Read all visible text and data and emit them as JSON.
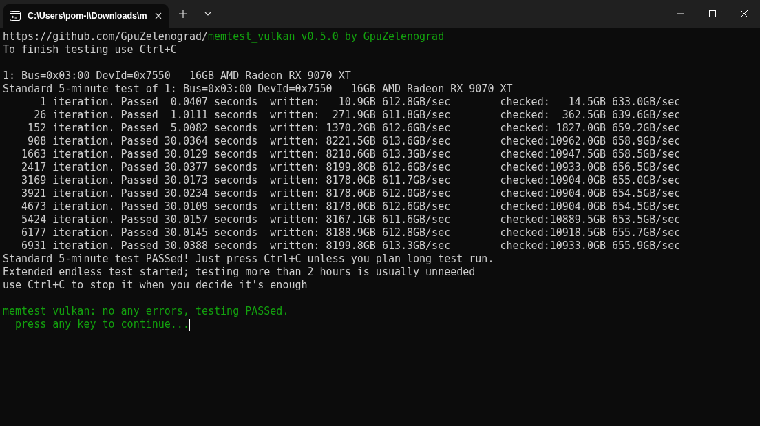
{
  "tab": {
    "title": "C:\\Users\\pom-l\\Downloads\\m",
    "selected": true
  },
  "terminal": {
    "lines": [
      {
        "kind": "text",
        "segments": [
          {
            "text": "https://github.com/GpuZelenograd/",
            "color": "#cccccc"
          },
          {
            "text": "memtest_vulkan v0.5.0 by GpuZelenograd",
            "color": "#13a10e"
          }
        ]
      },
      {
        "kind": "text",
        "segments": [
          {
            "text": "To finish testing use Ctrl+C",
            "color": "#cccccc"
          }
        ]
      },
      {
        "kind": "blank"
      },
      {
        "kind": "text",
        "segments": [
          {
            "text": "1: Bus=0x03:00 DevId=0x7550   16GB AMD Radeon RX 9070 XT",
            "color": "#cccccc"
          }
        ]
      },
      {
        "kind": "text",
        "segments": [
          {
            "text": "Standard 5-minute test of 1: Bus=0x03:00 DevId=0x7550   16GB AMD Radeon RX 9070 XT",
            "color": "#cccccc"
          }
        ]
      },
      {
        "kind": "text",
        "segments": [
          {
            "text": "      1 iteration. Passed  0.0407 seconds  written:   10.9GB 612.8GB/sec        checked:   14.5GB 633.0GB/sec",
            "color": "#cccccc"
          }
        ]
      },
      {
        "kind": "text",
        "segments": [
          {
            "text": "     26 iteration. Passed  1.0111 seconds  written:  271.9GB 611.8GB/sec        checked:  362.5GB 639.6GB/sec",
            "color": "#cccccc"
          }
        ]
      },
      {
        "kind": "text",
        "segments": [
          {
            "text": "    152 iteration. Passed  5.0082 seconds  written: 1370.2GB 612.6GB/sec        checked: 1827.0GB 659.2GB/sec",
            "color": "#cccccc"
          }
        ]
      },
      {
        "kind": "text",
        "segments": [
          {
            "text": "    908 iteration. Passed 30.0364 seconds  written: 8221.5GB 613.6GB/sec        checked:10962.0GB 658.9GB/sec",
            "color": "#cccccc"
          }
        ]
      },
      {
        "kind": "text",
        "segments": [
          {
            "text": "   1663 iteration. Passed 30.0129 seconds  written: 8210.6GB 613.3GB/sec        checked:10947.5GB 658.5GB/sec",
            "color": "#cccccc"
          }
        ]
      },
      {
        "kind": "text",
        "segments": [
          {
            "text": "   2417 iteration. Passed 30.0377 seconds  written: 8199.8GB 612.6GB/sec        checked:10933.0GB 656.5GB/sec",
            "color": "#cccccc"
          }
        ]
      },
      {
        "kind": "text",
        "segments": [
          {
            "text": "   3169 iteration. Passed 30.0173 seconds  written: 8178.0GB 611.7GB/sec        checked:10904.0GB 655.0GB/sec",
            "color": "#cccccc"
          }
        ]
      },
      {
        "kind": "text",
        "segments": [
          {
            "text": "   3921 iteration. Passed 30.0234 seconds  written: 8178.0GB 612.0GB/sec        checked:10904.0GB 654.5GB/sec",
            "color": "#cccccc"
          }
        ]
      },
      {
        "kind": "text",
        "segments": [
          {
            "text": "   4673 iteration. Passed 30.0109 seconds  written: 8178.0GB 612.6GB/sec        checked:10904.0GB 654.5GB/sec",
            "color": "#cccccc"
          }
        ]
      },
      {
        "kind": "text",
        "segments": [
          {
            "text": "   5424 iteration. Passed 30.0157 seconds  written: 8167.1GB 611.6GB/sec        checked:10889.5GB 653.5GB/sec",
            "color": "#cccccc"
          }
        ]
      },
      {
        "kind": "text",
        "segments": [
          {
            "text": "   6177 iteration. Passed 30.0145 seconds  written: 8188.9GB 612.8GB/sec        checked:10918.5GB 655.7GB/sec",
            "color": "#cccccc"
          }
        ]
      },
      {
        "kind": "text",
        "segments": [
          {
            "text": "   6931 iteration. Passed 30.0388 seconds  written: 8199.8GB 613.3GB/sec        checked:10933.0GB 655.9GB/sec",
            "color": "#cccccc"
          }
        ]
      },
      {
        "kind": "text",
        "segments": [
          {
            "text": "Standard 5-minute test PASSed! Just press Ctrl+C unless you plan long test run.",
            "color": "#cccccc"
          }
        ]
      },
      {
        "kind": "text",
        "segments": [
          {
            "text": "Extended endless test started; testing more than 2 hours is usually unneeded",
            "color": "#cccccc"
          }
        ]
      },
      {
        "kind": "text",
        "segments": [
          {
            "text": "use Ctrl+C to stop it when you decide it's enough",
            "color": "#cccccc"
          }
        ]
      },
      {
        "kind": "blank"
      },
      {
        "kind": "text",
        "segments": [
          {
            "text": "memtest_vulkan: no any errors, testing PASSed.",
            "color": "#13a10e"
          }
        ]
      },
      {
        "kind": "prompt",
        "segments": [
          {
            "text": "  press any key to continue...",
            "color": "#13a10e"
          }
        ]
      }
    ]
  }
}
